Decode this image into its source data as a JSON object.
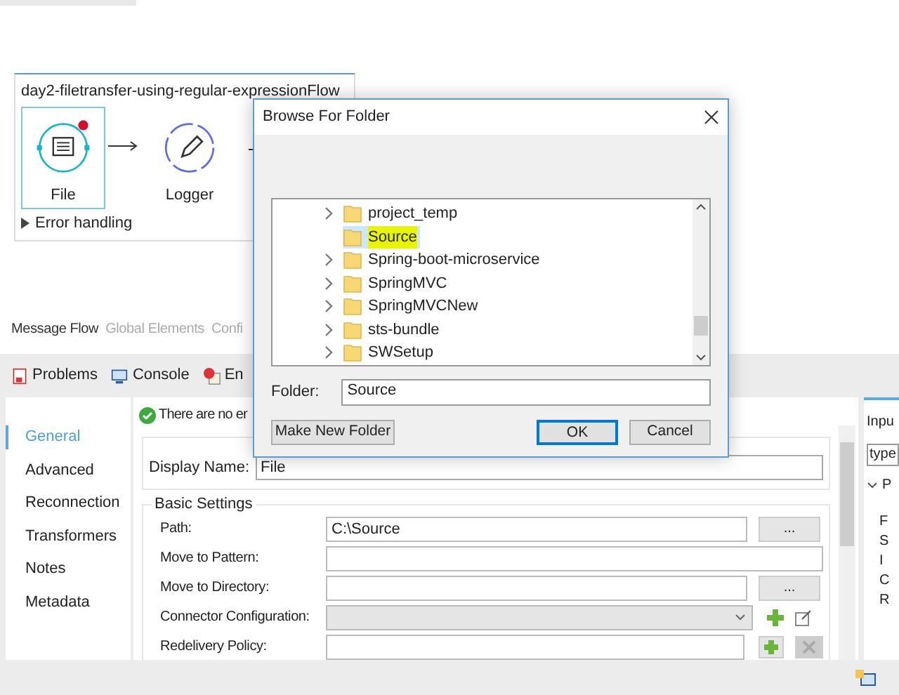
{
  "flow": {
    "title": "day2-filetransfer-using-regular-expressionFlow",
    "nodes": [
      {
        "label": "File",
        "kind": "file",
        "selected": true,
        "error": true
      },
      {
        "label": "Logger",
        "kind": "logger",
        "selected": false,
        "error": false
      }
    ],
    "error_handling": "Error handling"
  },
  "editor_tabs": [
    {
      "label": "Message Flow",
      "selected": true
    },
    {
      "label": "Global Elements",
      "selected": false
    },
    {
      "label": "Confi",
      "selected": false
    }
  ],
  "views": [
    {
      "label": "Problems",
      "kind": "problems"
    },
    {
      "label": "Console",
      "kind": "console"
    },
    {
      "label": "En",
      "kind": "error"
    }
  ],
  "properties": {
    "status": "There are no er",
    "nav": [
      {
        "label": "General",
        "selected": true
      },
      {
        "label": "Advanced",
        "selected": false
      },
      {
        "label": "Reconnection",
        "selected": false
      },
      {
        "label": "Transformers",
        "selected": false
      },
      {
        "label": "Notes",
        "selected": false
      },
      {
        "label": "Metadata",
        "selected": false
      }
    ],
    "display_name": {
      "label": "Display Name:",
      "value": "File"
    },
    "group": "Basic Settings",
    "rows": [
      {
        "label": "Path:",
        "value": "C:\\Source",
        "kind": "browse",
        "button": "..."
      },
      {
        "label": "Move to Pattern:",
        "value": "",
        "kind": "text"
      },
      {
        "label": "Move to Directory:",
        "value": "",
        "kind": "browse",
        "button": "..."
      },
      {
        "label": "Connector Configuration:",
        "value": "",
        "kind": "select"
      },
      {
        "label": "Redelivery Policy:",
        "value": "",
        "kind": "policy"
      }
    ]
  },
  "side_panel": {
    "tab": "Inpu",
    "filter": "type",
    "tree_root": "P",
    "items": [
      "F",
      "S",
      "I",
      "C",
      "R"
    ]
  },
  "dialog": {
    "title": "Browse For Folder",
    "tree": [
      {
        "label": "project_temp",
        "expandable": true,
        "selected": false
      },
      {
        "label": "Source",
        "expandable": false,
        "selected": true
      },
      {
        "label": "Spring-boot-microservice",
        "expandable": true,
        "selected": false
      },
      {
        "label": "SpringMVC",
        "expandable": true,
        "selected": false
      },
      {
        "label": "SpringMVCNew",
        "expandable": true,
        "selected": false
      },
      {
        "label": "sts-bundle",
        "expandable": true,
        "selected": false
      },
      {
        "label": "SWSetup",
        "expandable": true,
        "selected": false
      }
    ],
    "folder_label": "Folder:",
    "folder_value": "Source",
    "buttons": [
      {
        "label": "Make New Folder",
        "kind": "secondary"
      },
      {
        "label": "OK",
        "kind": "default"
      },
      {
        "label": "Cancel",
        "kind": "secondary"
      }
    ]
  }
}
